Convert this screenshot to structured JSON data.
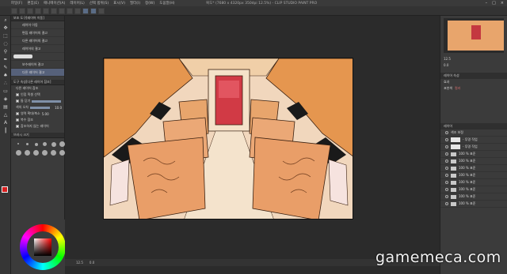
{
  "window": {
    "title": "복도* (7680 x 4320px 350dpi 12.5%) - CLIP STUDIO PAINT PRO",
    "menu": [
      "파일(F)",
      "편집(E)",
      "애니메이션(A)",
      "레이어(L)",
      "선택 범위(S)",
      "표시(V)",
      "필터(I)",
      "창(W)",
      "도움말(H)"
    ],
    "controls": [
      "–",
      "□",
      "×"
    ]
  },
  "toolbar": {
    "buttons": [
      "new",
      "open",
      "save",
      "undo",
      "redo",
      "clear",
      "fill",
      "transform",
      "hide",
      "brush-a",
      "brush-b",
      "brush-c"
    ]
  },
  "tools": [
    "zoom",
    "move",
    "select",
    "lasso",
    "eyedropper",
    "pen",
    "pencil",
    "brush",
    "airbrush",
    "eraser",
    "fill",
    "gradient",
    "shape",
    "text",
    "ruler"
  ],
  "subtool_panel": {
    "title": "보조 도구[레이어 이동]",
    "items": [
      "레이어 이동",
      "편집 레이어의 결고",
      "다른 레이어의 결고",
      "레이어의 결고",
      "보수레이어 결고",
      "레이어 결고 몰림",
      "다른 레이어 결고",
      "…"
    ]
  },
  "tool_property": {
    "title": "도구 속성[다른 레이어 참조]",
    "heading": "다른 레이어 참조",
    "rows": [
      {
        "label": "인접 픽셀 선택",
        "value": ""
      },
      {
        "label": "틈 닫기",
        "value": ""
      },
      {
        "label": "색의 오차",
        "value": "10.0"
      },
      {
        "label": "영역 확대/축소",
        "value": "5.00"
      },
      {
        "label": "복수 참조",
        "value": ""
      },
      {
        "label": "참조하지 않는 레이어",
        "value": ""
      }
    ]
  },
  "brush_size_panel": {
    "title": "브러시 크기"
  },
  "status": {
    "zoom": "12.5",
    "angle": "0.0"
  },
  "navigator": {
    "zoom": "12.5",
    "angle": "0.0"
  },
  "layer_property": {
    "title": "레이어 속성",
    "effect": "효과",
    "color": "표현색",
    "mode": "컬러"
  },
  "layers": {
    "title": "레이어",
    "items": [
      {
        "name": "색조 보정",
        "type": "layer"
      },
      {
        "name": "- 투명 작업",
        "type": "layer"
      },
      {
        "name": "- 투명 작업",
        "type": "layer"
      },
      {
        "name": "100 % 표준",
        "type": "folder"
      },
      {
        "name": "100 % 표준",
        "type": "folder"
      },
      {
        "name": "100 % 표준",
        "type": "folder"
      },
      {
        "name": "100 % 표준",
        "type": "folder"
      },
      {
        "name": "100 % 표준",
        "type": "folder"
      },
      {
        "name": "100 % 표준",
        "type": "folder"
      },
      {
        "name": "100 % 표준",
        "type": "folder"
      },
      {
        "name": "100 % 표준",
        "type": "folder"
      },
      {
        "name": "100 % 표준",
        "type": "folder"
      },
      {
        "name": "100 % 표준",
        "type": "folder"
      }
    ]
  },
  "watermark": "gamemeca.com",
  "colors": {
    "accent": "#56617a",
    "fg": "#d81f1f",
    "bg": "#ffffff",
    "door": "#c43840",
    "seat": "#e8a56c"
  }
}
